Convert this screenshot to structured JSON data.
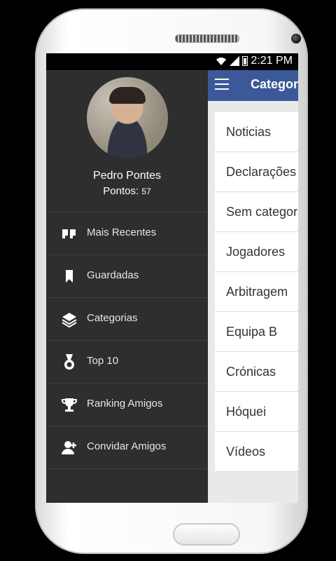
{
  "status_bar": {
    "time": "2:21 PM"
  },
  "app_bar": {
    "title": "Categor"
  },
  "profile": {
    "name": "Pedro Pontes",
    "points_label": "Pontos:",
    "points_value": "57"
  },
  "menu": [
    {
      "label": "Mais Recentes",
      "icon": "quote-icon"
    },
    {
      "label": "Guardadas",
      "icon": "bookmark-icon"
    },
    {
      "label": "Categorias",
      "icon": "layers-icon"
    },
    {
      "label": "Top 10",
      "icon": "medal-icon"
    },
    {
      "label": "Ranking Amigos",
      "icon": "trophy-icon"
    },
    {
      "label": "Convidar Amigos",
      "icon": "add-person-icon"
    }
  ],
  "categories": [
    "Noticias",
    "Declarações",
    "Sem categor",
    "Jogadores",
    "Arbitragem",
    "Equipa B",
    "Crónicas",
    "Hóquei",
    "Vídeos"
  ],
  "colors": {
    "app_bar": "#3b5998",
    "drawer": "#2e2e2e"
  }
}
